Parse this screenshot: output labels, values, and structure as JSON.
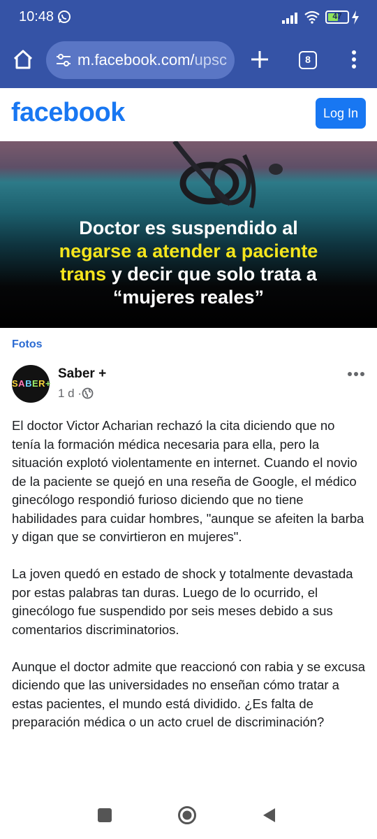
{
  "status_bar": {
    "time": "10:48",
    "battery": "47"
  },
  "browser": {
    "url_host": "m.facebook.com/",
    "url_path": "upsc",
    "tab_count": "8"
  },
  "header": {
    "logo": "facebook",
    "login_label": "Log In"
  },
  "hero": {
    "line1": "Doctor es suspendido al",
    "highlight1": "negarse a atender a paciente",
    "highlight2": "trans",
    "line3_rest": " y decir que solo trata a",
    "line4": "“mujeres reales”"
  },
  "post": {
    "section_label": "Fotos",
    "avatar_text": "SABER+",
    "author": "Saber +",
    "time": "1 d ·",
    "paragraphs": [
      "El doctor Victor Acharian rechazó la cita diciendo que no tenía la formación médica necesaria para ella, pero la situación explotó violentamente en internet. Cuando el novio de la paciente se quejó en una reseña de Google, el médico ginecólogo respondió furioso diciendo que no tiene habilidades para cuidar hombres, \"aunque se afeiten la barba y digan que se convirtieron en mujeres\".",
      "La joven quedó en estado de shock y totalmente devastada por estas palabras tan duras. Luego de lo ocurrido, el ginecólogo fue suspendido por seis meses debido a sus comentarios discriminatorios.",
      "Aunque el doctor admite que reaccionó con rabia y se excusa diciendo que las universidades no enseñan cómo tratar a estas pacientes, el mundo está dividido. ¿Es falta de preparación médica o un acto cruel de discriminación?"
    ]
  },
  "colors": {
    "chrome": "#3553a6",
    "facebook_blue": "#1877f2",
    "highlight": "#f5e51d",
    "link": "#2b6bd2"
  }
}
